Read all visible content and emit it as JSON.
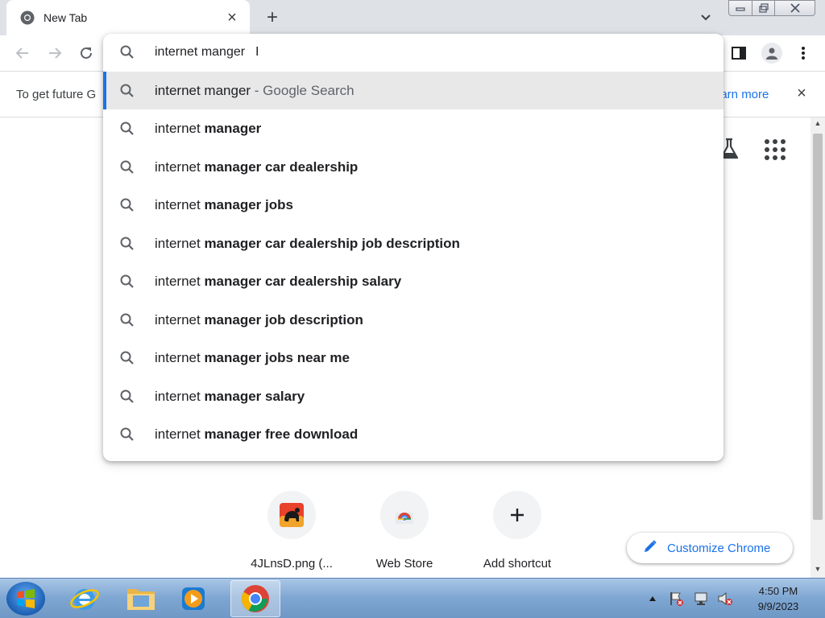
{
  "tab": {
    "title": "New Tab"
  },
  "omnibox": {
    "input_value": "internet manger",
    "suggestions": [
      {
        "prefix": "internet manger",
        "bold": "",
        "suffix": " - Google Search",
        "selected": true
      },
      {
        "prefix": "internet ",
        "bold": "manager",
        "suffix": ""
      },
      {
        "prefix": "internet ",
        "bold": "manager car dealership",
        "suffix": ""
      },
      {
        "prefix": "internet ",
        "bold": "manager jobs",
        "suffix": ""
      },
      {
        "prefix": "internet ",
        "bold": "manager car dealership job description",
        "suffix": ""
      },
      {
        "prefix": "internet ",
        "bold": "manager car dealership salary",
        "suffix": ""
      },
      {
        "prefix": "internet ",
        "bold": "manager job description",
        "suffix": ""
      },
      {
        "prefix": "internet ",
        "bold": "manager jobs near me",
        "suffix": ""
      },
      {
        "prefix": "internet ",
        "bold": "manager salary",
        "suffix": ""
      },
      {
        "prefix": "internet ",
        "bold": "manager free download",
        "suffix": ""
      }
    ]
  },
  "infobar": {
    "text": "To get future G",
    "link": "earn more"
  },
  "shortcuts": [
    {
      "label": "4JLnsD.png (...",
      "icon": "monkey-logo-icon"
    },
    {
      "label": "Web Store",
      "icon": "chrome-web-store-icon"
    },
    {
      "label": "Add shortcut",
      "icon": "plus-icon"
    }
  ],
  "customize": {
    "label": "Customize Chrome"
  },
  "taskbar": {
    "apps": [
      "internet-explorer-icon",
      "file-explorer-icon",
      "media-player-icon",
      "chrome-icon"
    ],
    "time": "4:50 PM",
    "date": "9/9/2023"
  },
  "colors": {
    "accent": "#1a73e8",
    "selected_row": "#e8e8e9",
    "tab_strip": "#dee1e6"
  }
}
